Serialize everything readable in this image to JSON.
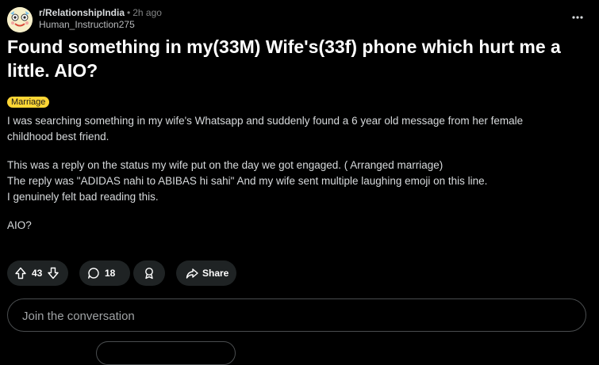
{
  "post": {
    "subreddit": "r/RelationshipIndia",
    "separator": "•",
    "time": "2h ago",
    "author": "Human_Instruction275",
    "title": "Found something in my(33M) Wife's(33f) phone which hurt me a little. AIO?",
    "flair": "Marriage",
    "flair_color": "#ffd635",
    "body": {
      "p1_line1": "I was searching something in my wife's Whatsapp and suddenly found a 6 year old message from her female",
      "p1_line2": "childhood best friend.",
      "p2_line1": "This was a reply on the status my wife put on the day we got engaged. ( Arranged marriage)",
      "p2_line2": "The reply was \"ADIDAS nahi to ABIBAS hi sahi\" And my wife sent multiple laughing emoji on this line.",
      "p2_line3": "I genuinely felt bad reading this.",
      "p3_line1": "AIO?"
    }
  },
  "actions": {
    "upvotes": "43",
    "comments": "18",
    "share_label": "Share",
    "icons": [
      "upvote-icon",
      "downvote-icon",
      "comment-icon",
      "award-icon",
      "share-icon",
      "more-icon"
    ]
  },
  "comment_box": {
    "placeholder": "Join the conversation"
  }
}
